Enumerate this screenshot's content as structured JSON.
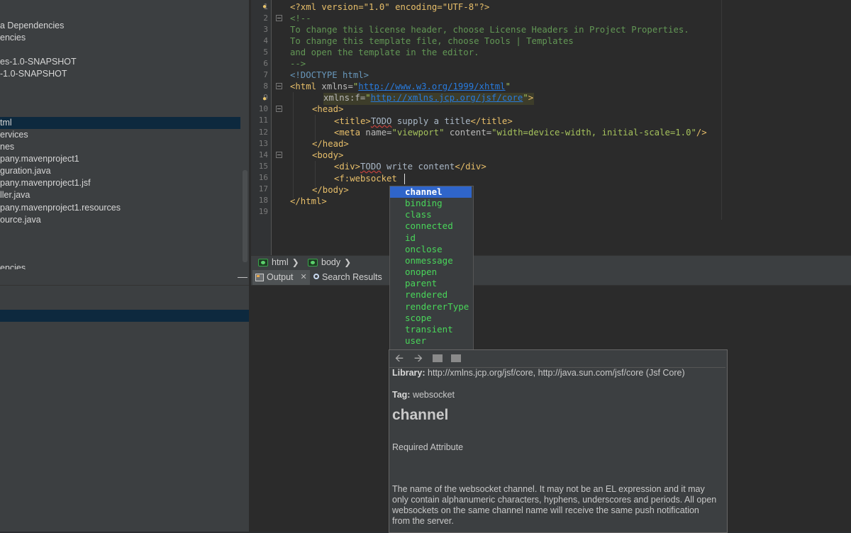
{
  "project_tree": {
    "items": [
      {
        "label": "a Dependencies"
      },
      {
        "label": "encies"
      },
      {
        "label": "es-1.0-SNAPSHOT"
      },
      {
        "label": "-1.0-SNAPSHOT"
      },
      {
        "label": "tml",
        "selected": true
      },
      {
        "label": "ervices"
      },
      {
        "label": "nes"
      },
      {
        "label": "pany.mavenproject1"
      },
      {
        "label": "guration.java"
      },
      {
        "label": "pany.mavenproject1.jsf"
      },
      {
        "label": "ller.java"
      },
      {
        "label": "pany.mavenproject1.resources"
      },
      {
        "label": "ource.java"
      },
      {
        "label": "encies"
      }
    ],
    "minimize_label": "—"
  },
  "editor": {
    "line_numbers": [
      "1",
      "2",
      "3",
      "4",
      "5",
      "6",
      "7",
      "8",
      "9",
      "10",
      "11",
      "12",
      "13",
      "14",
      "15",
      "16",
      "17",
      "18",
      "19"
    ],
    "lines": {
      "l1": "<?xml version=\"1.0\" encoding=\"UTF-8\"?>",
      "l2": "<!--",
      "l3": "To change this license header, choose License Headers in Project Properties.",
      "l4": "To change this template file, choose Tools | Templates",
      "l5": "and open the template in the editor.",
      "l6": "-->",
      "l7": "<!DOCTYPE html>",
      "l8_tag": "<html",
      "l8_attr": " xmlns=",
      "l8_q1": "\"",
      "l8_url": "http://www.w3.org/1999/xhtml",
      "l8_q2": "\"",
      "l9_attr": "xmlns:f=",
      "l9_q1": "\"",
      "l9_url": "http://xmlns.jcp.org/jsf/core",
      "l9_q2": "\"",
      "l9_end": ">",
      "l10": "<head>",
      "l11_open": "<title>",
      "l11_todo": "TODO",
      "l11_text": " supply a title",
      "l11_close": "</title>",
      "l12_tag": "<meta",
      "l12_a1": " name=",
      "l12_v1": "\"viewport\"",
      "l12_a2": " content=",
      "l12_v2": "\"width=device-width, initial-scale=1.0\"",
      "l12_end": "/>",
      "l13": "</head>",
      "l14": "<body>",
      "l15_open": "<div>",
      "l15_todo": "TODO",
      "l15_text": " write content",
      "l15_close": "</div>",
      "l16": "<f:websocket ",
      "l17": "</body>",
      "l18": "</html>"
    }
  },
  "breadcrumb": {
    "items": [
      "html",
      "body"
    ]
  },
  "output_tabs": {
    "output": "Output",
    "search": "Search Results"
  },
  "completion": {
    "items": [
      "channel",
      "binding",
      "class",
      "connected",
      "id",
      "onclose",
      "onmessage",
      "onopen",
      "parent",
      "rendered",
      "rendererType",
      "scope",
      "transient",
      "user"
    ],
    "selected_index": 0
  },
  "doc": {
    "library_label": "Library:",
    "library_value": " http://xmlns.jcp.org/jsf/core, http://java.sun.com/jsf/core (Jsf Core)",
    "tag_label": "Tag:",
    "tag_value": " websocket",
    "title": "channel",
    "required": "Required Attribute",
    "description": "The name of the websocket channel. It may not be an EL expression and it may only contain alphanumeric characters, hyphens, underscores and periods. All open websockets on the same channel name will receive the same push notification from the server."
  },
  "colors": {
    "selection": "#2f65ca",
    "completion_text": "#49d65a",
    "tag": "#e8bf6a",
    "string": "#a5c25c",
    "comment": "#629755"
  }
}
